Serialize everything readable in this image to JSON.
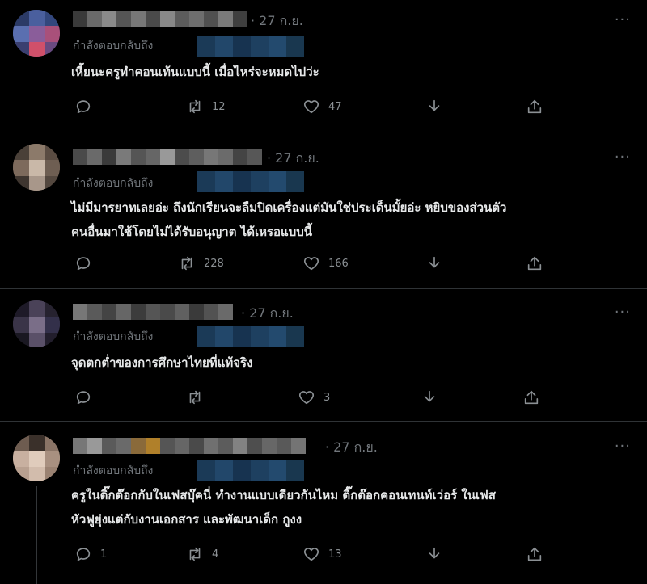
{
  "tweets": [
    {
      "time": "· 27 ก.ย.",
      "reply_label": "กำลังตอบกลับถึง",
      "lines": [
        "เหี้ยนะครูทำคอนเท้นแบบนี้ เมื่อไหร่จะหมดไปว่ะ"
      ],
      "replies": "",
      "retweets": "12",
      "likes": "47"
    },
    {
      "time": "· 27 ก.ย.",
      "reply_label": "กำลังตอบกลับถึง",
      "lines": [
        "ไม่มีมารยาทเลยอ่ะ ถึงนักเรียนจะลืมปิดเครื่องแต่มันใช่ประเด็นมั้ยอ่ะ หยิบของส่วนตัว",
        "คนอื่นมาใช้โดยไม่ได้รับอนุญาต ได้เหรอแบบนี้"
      ],
      "replies": "",
      "retweets": "228",
      "likes": "166"
    },
    {
      "time": "· 27 ก.ย.",
      "reply_label": "กำลังตอบกลับถึง",
      "lines": [
        "จุดตกต่ำของการศึกษาไทยที่แท้จริง"
      ],
      "replies": "",
      "retweets": "",
      "likes": "3"
    },
    {
      "time": "· 27 ก.ย.",
      "reply_label": "กำลังตอบกลับถึง",
      "lines": [
        "ครูในติ๊กต๊อกกับในเฟสบุ๊คนี่ ทำงานแบบเดียวกันไหม ติ๊กต๊อกคอนเทนท์เว่อร์ ในเฟส",
        "หัวฟูยุ่งแต่กับงานเอกสาร และพัฒนาเด็ก กูงง"
      ],
      "replies": "1",
      "retweets": "4",
      "likes": "13"
    }
  ],
  "icons": {
    "reply": "reply-icon",
    "retweet": "retweet-icon",
    "like": "heart-icon",
    "download": "download-icon",
    "share": "share-icon",
    "more": "more-icon"
  },
  "more_glyph": "···",
  "colors": {
    "background": "#000000",
    "text": "#e7e9ea",
    "muted": "#71767b",
    "divider": "#2f3336",
    "mention_blur": "#1b3a57"
  }
}
